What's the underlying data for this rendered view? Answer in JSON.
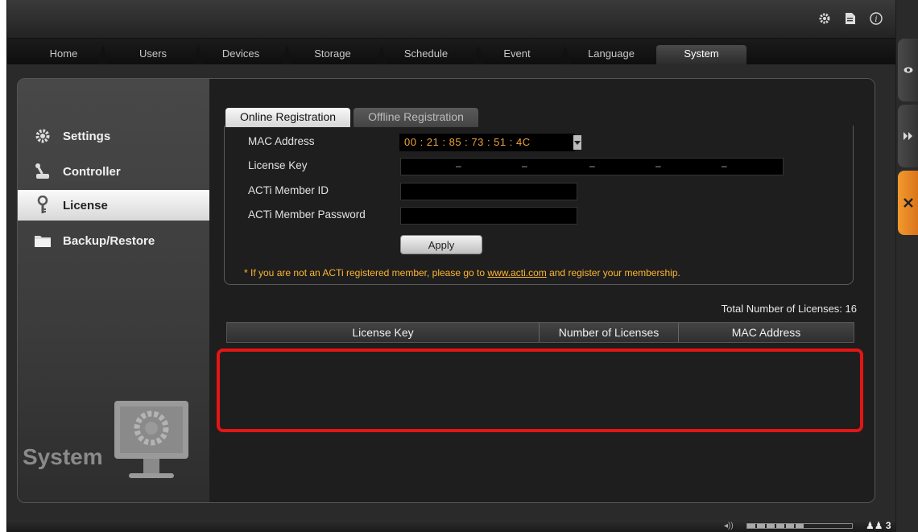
{
  "nav": {
    "tabs": [
      {
        "label": "Home"
      },
      {
        "label": "Users"
      },
      {
        "label": "Devices"
      },
      {
        "label": "Storage"
      },
      {
        "label": "Schedule"
      },
      {
        "label": "Event"
      },
      {
        "label": "Language"
      },
      {
        "label": "System",
        "active": true
      }
    ]
  },
  "top_icons": [
    "gear-icon",
    "document-icon",
    "info-icon"
  ],
  "sidebar": {
    "items": [
      {
        "label": "Settings",
        "icon": "gear-icon"
      },
      {
        "label": "Controller",
        "icon": "joystick-icon"
      },
      {
        "label": "License",
        "icon": "key-icon",
        "active": true
      },
      {
        "label": "Backup/Restore",
        "icon": "folder-icon"
      }
    ],
    "section_label": "System"
  },
  "registration": {
    "tabs": [
      {
        "label": "Online Registration",
        "active": true
      },
      {
        "label": "Offline Registration"
      }
    ],
    "fields": {
      "mac_label": "MAC Address",
      "mac_value": "00 : 21 : 85 : 73 : 51 : 4C",
      "license_key_label": "License Key",
      "license_key_separator": "–",
      "member_id_label": "ACTi Member ID",
      "member_password_label": "ACTi Member Password"
    },
    "apply_label": "Apply",
    "note_prefix": "* If you are not an ACTi registered member, please go to ",
    "note_link": "www.acti.com",
    "note_suffix": " and register your membership."
  },
  "licenses": {
    "total_label": "Total Number of Licenses: 16",
    "columns": [
      "License Key",
      "Number of Licenses",
      "MAC Address"
    ],
    "rows": []
  },
  "status": {
    "volume_level": 0.55,
    "user_count": "3"
  },
  "rail": [
    "eye-icon",
    "fast-forward-icon",
    "tools-icon"
  ],
  "colors": {
    "accent": "#f0a23c",
    "highlight": "#e31515",
    "rail_active": "#e8841f"
  }
}
